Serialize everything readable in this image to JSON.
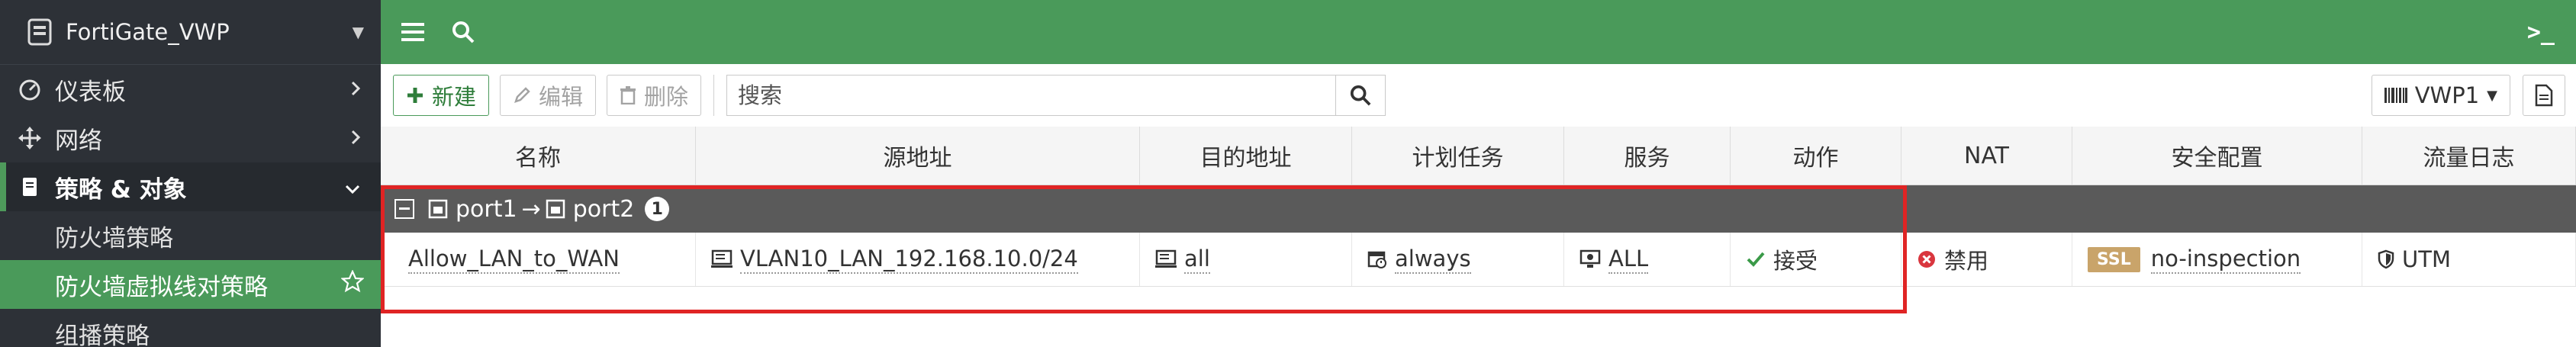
{
  "sidebar": {
    "device_name": "FortiGate_VWP",
    "items": [
      {
        "label": "仪表板",
        "icon": "dashboard-icon"
      },
      {
        "label": "网络",
        "icon": "network-icon"
      },
      {
        "label": "策略 & 对象",
        "icon": "policy-icon"
      }
    ],
    "subitems": [
      {
        "label": "防火墙策略"
      },
      {
        "label": "防火墙虚拟线对策略"
      },
      {
        "label": "组播策略"
      }
    ]
  },
  "topbar": {
    "cli_label": ">_"
  },
  "toolbar": {
    "new_label": "新建",
    "edit_label": "编辑",
    "delete_label": "删除",
    "search_placeholder": "搜索",
    "vdom_label": "VWP1"
  },
  "table": {
    "columns": [
      "名称",
      "源地址",
      "目的地址",
      "计划任务",
      "服务",
      "动作",
      "NAT",
      "安全配置",
      "流量日志"
    ],
    "group": {
      "from": "port1",
      "arrow": "→",
      "to": "port2",
      "count": "1"
    },
    "rows": [
      {
        "name": "Allow_LAN_to_WAN",
        "source": "VLAN10_LAN_192.168.10.0/24",
        "destination": "all",
        "schedule": "always",
        "service": "ALL",
        "action": "接受",
        "nat": "禁用",
        "security_badge": "SSL",
        "security": "no-inspection",
        "log": "UTM"
      }
    ]
  },
  "colors": {
    "brand_green": "#4a9a5a",
    "sidebar_bg": "#2d3137",
    "highlight_red": "#e02424",
    "accept_green": "#3a9a48",
    "nat_red": "#d9363e"
  }
}
